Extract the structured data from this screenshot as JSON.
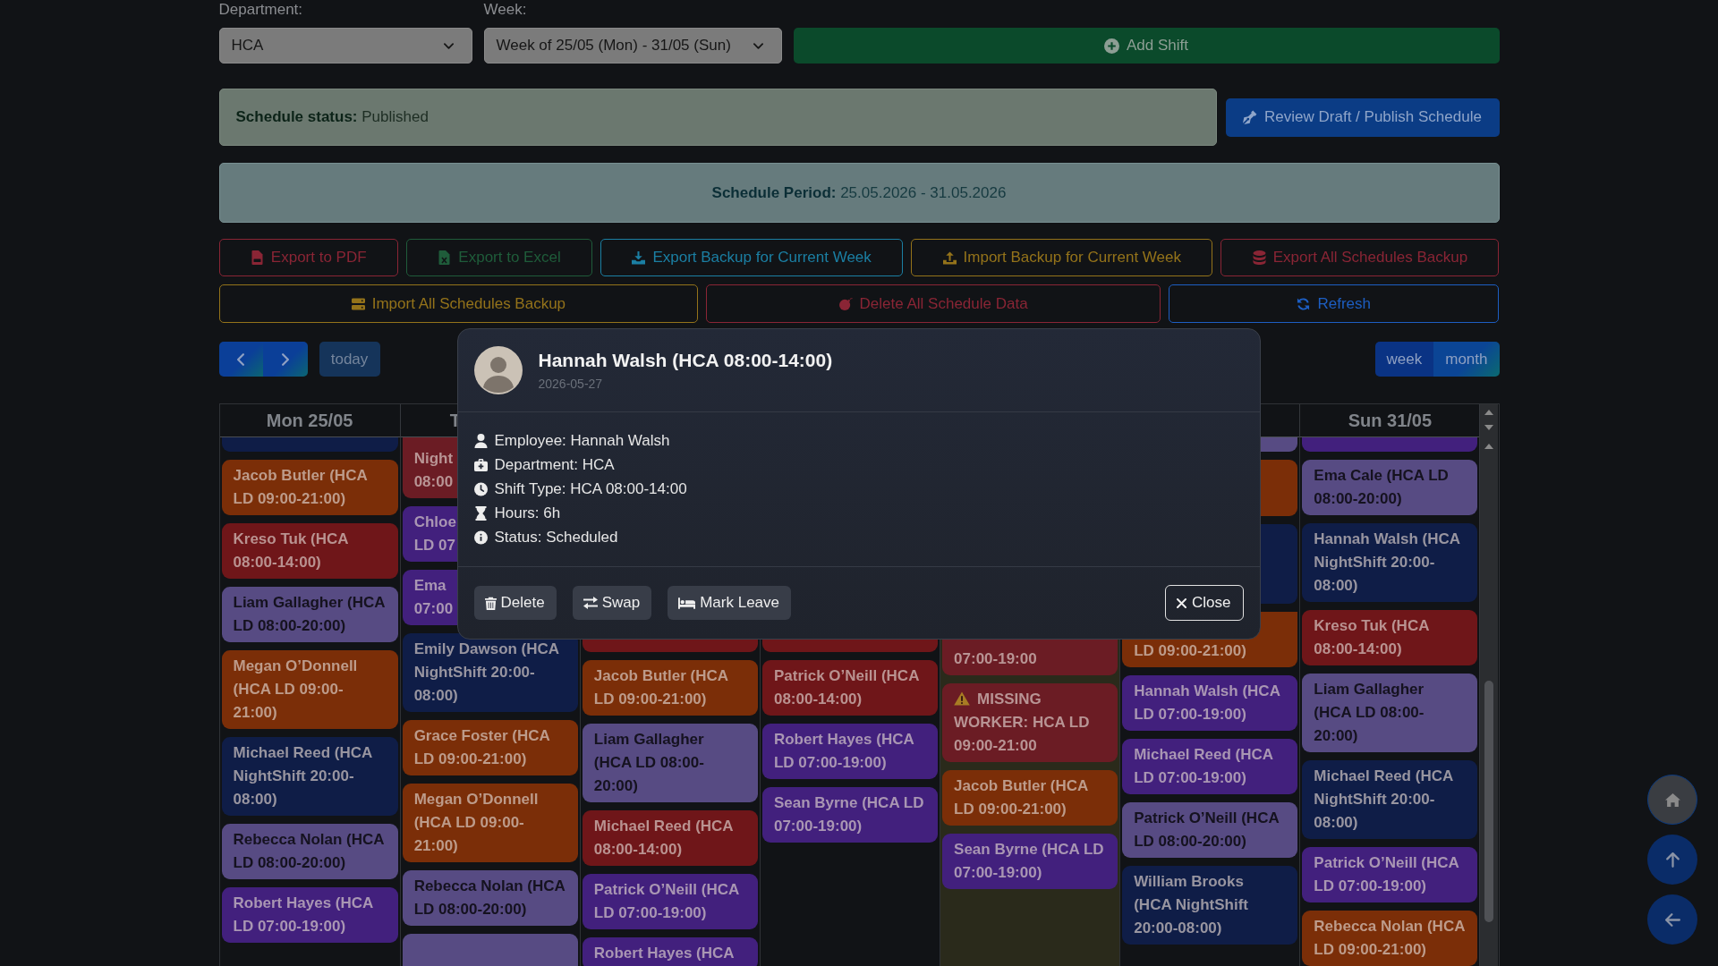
{
  "filters": {
    "department": {
      "label": "Department:",
      "value": "HCA"
    },
    "week": {
      "label": "Week:",
      "value": "Week of 25/05 (Mon) - 31/05 (Sun)"
    },
    "add_button": {
      "label": "Add Shift"
    }
  },
  "status": {
    "label": "Schedule status:",
    "value": "Published",
    "button": "Review Draft / Publish Schedule"
  },
  "period": {
    "label": "Schedule Period:",
    "value": "25.05.2026 - 31.05.2026"
  },
  "action_rows": [
    {
      "buttons": [
        {
          "label": "Export to PDF",
          "kind": "pdf",
          "color": "#8a2535"
        },
        {
          "label": "Export to Excel",
          "kind": "excel",
          "color": "#1f5c3a"
        },
        {
          "label": "Export Backup for Current Week",
          "kind": "download",
          "color": "#1b7fa3"
        },
        {
          "label": "Import Backup for Current Week",
          "kind": "upload",
          "color": "#94731a"
        },
        {
          "label": "Export All Schedules Backup",
          "kind": "database",
          "color": "#8a2535"
        }
      ]
    },
    {
      "buttons": [
        {
          "label": "Import All Schedules Backup",
          "kind": "server",
          "color": "#94731a"
        },
        {
          "label": "Delete All Schedule Data",
          "kind": "bomb",
          "color": "#8a2535"
        },
        {
          "label": "Refresh",
          "kind": "refresh",
          "color": "#1d5ec2"
        }
      ]
    }
  ],
  "toolbar": {
    "today": {
      "label": "today",
      "disabled": true
    },
    "views": [
      {
        "label": "week",
        "selected": true
      },
      {
        "label": "month",
        "selected": false
      }
    ]
  },
  "calendar": {
    "days": [
      {
        "header": "Mon 25/05",
        "today": false,
        "events": [
          {
            "kind": "clipped",
            "color": "#0f1d47"
          },
          {
            "kind": "shift",
            "color": "#7b2e08",
            "text": "Jacob Butler (HCA LD 09:00-21:00)"
          },
          {
            "kind": "shift",
            "color": "#6f1619",
            "text": "Kreso Tuk (HCA 08:00-14:00)"
          },
          {
            "kind": "shift",
            "color": "#574b83",
            "text": "Liam Gallagher (HCA LD 08:00-20:00)"
          },
          {
            "kind": "shift",
            "color": "#7b2e08",
            "text": "Megan O’Donnell (HCA LD 09:00-21:00)"
          },
          {
            "kind": "shift",
            "color": "#0f1d47",
            "text": "Michael Reed (HCA NightShift 20:00-08:00)"
          },
          {
            "kind": "shift",
            "color": "#574b83",
            "text": "Rebecca Nolan (HCA LD 08:00-20:00)"
          },
          {
            "kind": "shift",
            "color": "#42207d",
            "text": "Robert Hayes (HCA LD 07:00-19:00)"
          }
        ]
      },
      {
        "header": "T",
        "today": false,
        "events": [
          {
            "kind": "clipped",
            "color": "#6b1c24",
            "text": "Night\n08:00"
          },
          {
            "kind": "shift",
            "color": "#42207d",
            "text": "Chloe\nLD 07"
          },
          {
            "kind": "shift",
            "color": "#42207d",
            "text": "Ema\n07:00"
          },
          {
            "kind": "shift",
            "color": "#0f1d47",
            "text": "Emily Dawson (HCA NightShift 20:00-08:00)"
          },
          {
            "kind": "shift",
            "color": "#7b2e08",
            "text": "Grace Foster (HCA LD 09:00-21:00)"
          },
          {
            "kind": "shift",
            "color": "#7b2e08",
            "text": "Megan O’Donnell (HCA LD 09:00-21:00)"
          },
          {
            "kind": "shift",
            "color": "#574b83",
            "text": "Rebecca Nolan (HCA LD 08:00-20:00)"
          },
          {
            "kind": "covered",
            "color": "#574b83"
          }
        ]
      },
      {
        "today": false,
        "events": [
          {
            "kind": "clipped",
            "color": "#6f1619"
          },
          {
            "kind": "shift",
            "color": "#7b2e08",
            "text": "Jacob Butler (HCA LD 09:00-21:00)"
          },
          {
            "kind": "shift",
            "color": "#574b83",
            "text": "Liam Gallagher (HCA LD 08:00-20:00)"
          },
          {
            "kind": "shift",
            "color": "#6f1619",
            "text": "Michael Reed (HCA 08:00-14:00)"
          },
          {
            "kind": "shift",
            "color": "#42207d",
            "text": "Patrick O’Neill (HCA LD 07:00-19:00)"
          },
          {
            "kind": "shift",
            "color": "#42207d",
            "text": "Robert Hayes (HCA"
          }
        ]
      },
      {
        "today": false,
        "events": [
          {
            "kind": "clipped",
            "color": "#6f1619"
          },
          {
            "kind": "shift",
            "color": "#6f1619",
            "text": "Patrick O’Neill (HCA 08:00-14:00)"
          },
          {
            "kind": "shift",
            "color": "#42207d",
            "text": "Robert Hayes (HCA LD 07:00-19:00)"
          },
          {
            "kind": "shift",
            "color": "#42207d",
            "text": "Sean Byrne (HCA LD 07:00-19:00)"
          }
        ]
      },
      {
        "today": true,
        "events": [
          {
            "kind": "clipped",
            "color": "#6b1c24",
            "text": "07:00-19:00"
          },
          {
            "kind": "missing",
            "color": "#6b1c24",
            "text": "MISSING WORKER: HCA LD 09:00-21:00"
          },
          {
            "kind": "shift",
            "color": "#7b2e08",
            "text": "Jacob Butler (HCA LD 09:00-21:00)"
          },
          {
            "kind": "shift",
            "color": "#42207d",
            "text": "Sean Byrne (HCA LD 07:00-19:00)"
          }
        ]
      },
      {
        "today": false,
        "events": [
          {
            "kind": "clipped",
            "color": "#574b83"
          },
          {
            "kind": "covered",
            "color": "#7b2e08"
          },
          {
            "kind": "covered",
            "color": "#0f1d47"
          },
          {
            "kind": "clipped",
            "color": "#7b2e08",
            "text": "LD 09:00-21:00)"
          },
          {
            "kind": "shift",
            "color": "#42207d",
            "text": "Hannah Walsh (HCA LD 07:00-19:00)"
          },
          {
            "kind": "shift",
            "color": "#42207d",
            "text": "Michael Reed (HCA LD 07:00-19:00)"
          },
          {
            "kind": "shift",
            "color": "#574b83",
            "text": "Patrick O’Neill (HCA LD 08:00-20:00)"
          },
          {
            "kind": "shift",
            "color": "#0f1d47",
            "text": "William Brooks (HCA NightShift 20:00-08:00)"
          }
        ]
      },
      {
        "header": "Sun 31/05",
        "today": false,
        "events": [
          {
            "kind": "clipped",
            "color": "#42207d"
          },
          {
            "kind": "shift",
            "color": "#574b83",
            "text": "Ema Cale (HCA LD 08:00-20:00)"
          },
          {
            "kind": "shift",
            "color": "#0f1d47",
            "text": "Hannah Walsh (HCA NightShift 20:00-08:00)"
          },
          {
            "kind": "shift",
            "color": "#6f1619",
            "text": "Kreso Tuk (HCA 08:00-14:00)"
          },
          {
            "kind": "shift",
            "color": "#574b83",
            "text": "Liam Gallagher (HCA LD 08:00-20:00)"
          },
          {
            "kind": "shift",
            "color": "#0f1d47",
            "text": "Michael Reed (HCA NightShift 20:00-08:00)"
          },
          {
            "kind": "shift",
            "color": "#42207d",
            "text": "Patrick O’Neill (HCA LD 07:00-19:00)"
          },
          {
            "kind": "shift",
            "color": "#7b2e08",
            "text": "Rebecca Nolan (HCA LD 09:00-21:00)"
          }
        ]
      }
    ]
  },
  "dialog": {
    "title": "Hannah Walsh (HCA 08:00-14:00)",
    "date": "2026-05-27",
    "details": [
      {
        "kind": "employee",
        "text": "Employee: Hannah Walsh"
      },
      {
        "kind": "department",
        "text": "Department: HCA"
      },
      {
        "kind": "shift_type",
        "text": "Shift Type: HCA 08:00-14:00"
      },
      {
        "kind": "hours",
        "text": "Hours: 6h"
      },
      {
        "kind": "status",
        "text": "Status: Scheduled"
      }
    ],
    "buttons": [
      {
        "label": "Delete",
        "kind": "delete"
      },
      {
        "label": "Swap",
        "kind": "swap"
      },
      {
        "label": "Mark Leave",
        "kind": "leave"
      }
    ],
    "close_button": "Close"
  },
  "floating_buttons": [
    {
      "kind": "home"
    },
    {
      "kind": "up"
    },
    {
      "kind": "back"
    }
  ]
}
